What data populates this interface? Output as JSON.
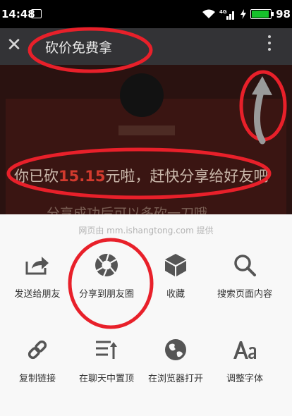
{
  "status_bar": {
    "time": "14:48",
    "signal_label": "4G",
    "battery": "98"
  },
  "title_bar": {
    "title": "砍价免费拿"
  },
  "page": {
    "msg_prefix": "你已砍",
    "amount": "15.15",
    "msg_suffix": "元啦，赶快分享给好友吧",
    "hint": "分享成功后可以多砍一刀哦"
  },
  "share_sheet": {
    "provider": "网页由 mm.ishangtong.com 提供",
    "row1": [
      {
        "label": "发送给朋友",
        "icon": "share-forward-icon"
      },
      {
        "label": "分享到朋友圈",
        "icon": "moments-icon"
      },
      {
        "label": "收藏",
        "icon": "favorite-cube-icon"
      },
      {
        "label": "搜索页面内容",
        "icon": "search-icon"
      }
    ],
    "row2": [
      {
        "label": "复制链接",
        "icon": "link-icon"
      },
      {
        "label": "在聊天中置顶",
        "icon": "pin-to-chat-icon"
      },
      {
        "label": "在浏览器打开",
        "icon": "browser-globe-icon"
      },
      {
        "label": "调整字体",
        "icon": "font-size-icon"
      }
    ]
  },
  "colors": {
    "annotation": "#e8202a",
    "accent_amount": "#d23a2e",
    "titlebar": "#333336",
    "sheet": "#f8f8f8"
  }
}
